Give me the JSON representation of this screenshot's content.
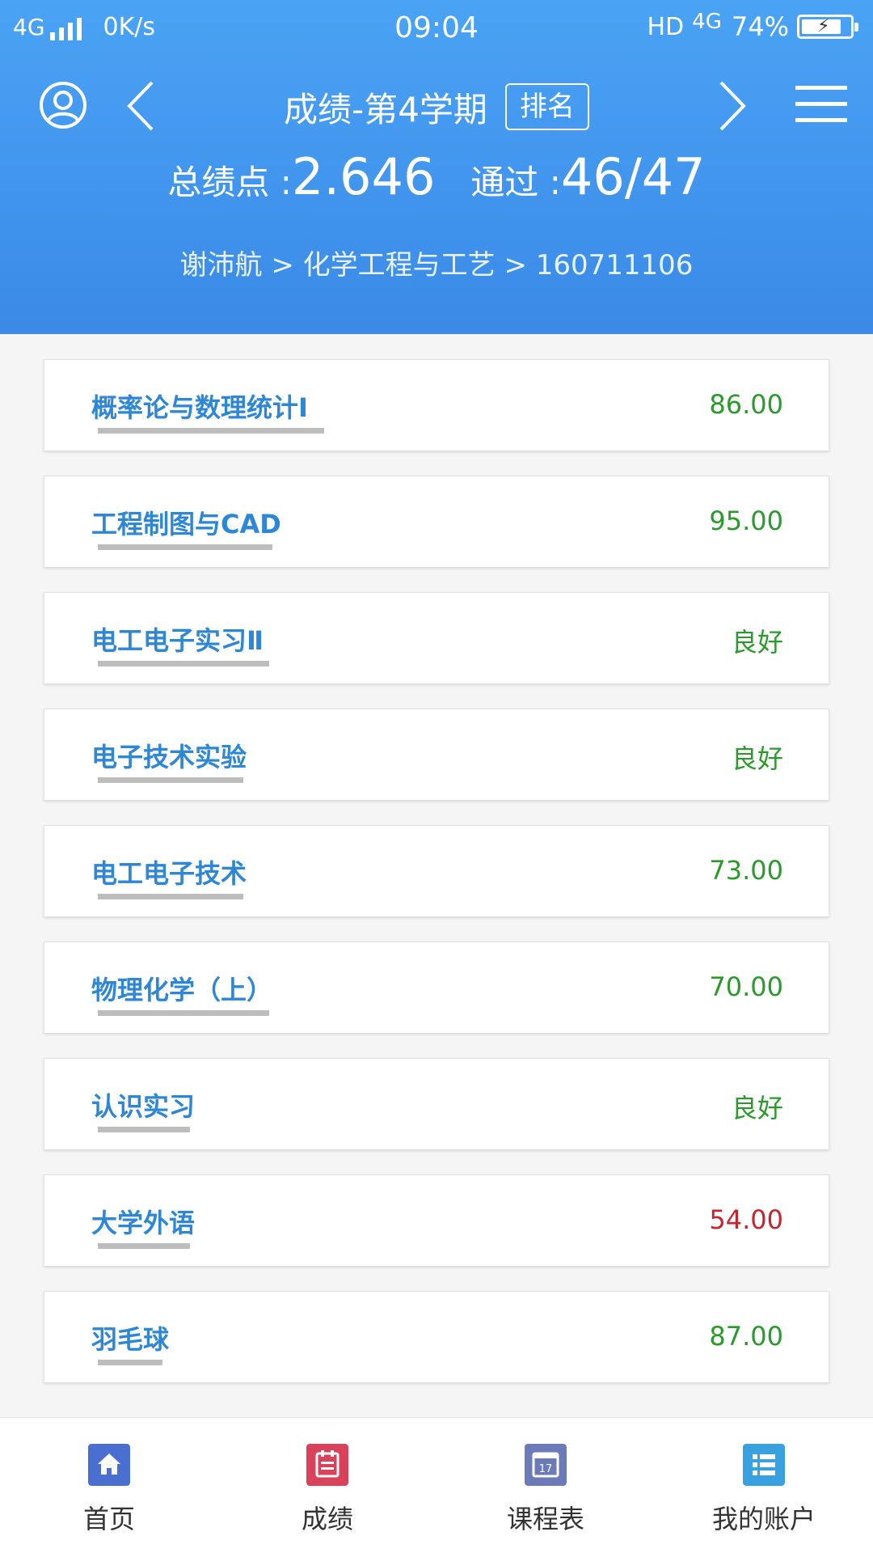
{
  "status_bar": {
    "network": "4G",
    "speed": "0K/s",
    "time": "09:04",
    "hd": "HD",
    "network_right": "4G",
    "battery": "74%"
  },
  "header": {
    "title": "成绩-第4学期",
    "rank_button": "排名",
    "gpa_label": "总绩点 : ",
    "gpa_value": "2.646",
    "pass_label": "通过 : ",
    "pass_value": "46/47",
    "breadcrumb": "谢沛航 > 化学工程与工艺 > 160711106"
  },
  "icons": {
    "user": "user-circle-icon",
    "back": "chevron-left-icon",
    "forward": "chevron-right-icon",
    "menu": "hamburger-menu-icon"
  },
  "courses": [
    {
      "name": "概率论与数理统计Ⅰ",
      "score": "86.00",
      "pass": true
    },
    {
      "name": "工程制图与CAD",
      "score": "95.00",
      "pass": true
    },
    {
      "name": "电工电子实习Ⅱ",
      "score": "良好",
      "pass": true
    },
    {
      "name": "电子技术实验",
      "score": "良好",
      "pass": true
    },
    {
      "name": "电工电子技术",
      "score": "73.00",
      "pass": true
    },
    {
      "name": "物理化学（上）",
      "score": "70.00",
      "pass": true
    },
    {
      "name": "认识实习",
      "score": "良好",
      "pass": true
    },
    {
      "name": "大学外语",
      "score": "54.00",
      "pass": false
    },
    {
      "name": "羽毛球",
      "score": "87.00",
      "pass": true
    }
  ],
  "colors": {
    "header_top": "#4aa3f5",
    "header_bottom": "#3a8ae6",
    "course_name": "#2d86d6",
    "score_pass": "#2a9a2a",
    "score_fail": "#c8232c"
  },
  "tabbar": [
    {
      "label": "首页",
      "icon": "home-icon",
      "color": "#4a6fd1"
    },
    {
      "label": "成绩",
      "icon": "scores-notebook-icon",
      "color": "#d9425a"
    },
    {
      "label": "课程表",
      "icon": "calendar-icon",
      "color": "#6d7ab8"
    },
    {
      "label": "我的账户",
      "icon": "account-list-icon",
      "color": "#3aa1e0"
    }
  ]
}
